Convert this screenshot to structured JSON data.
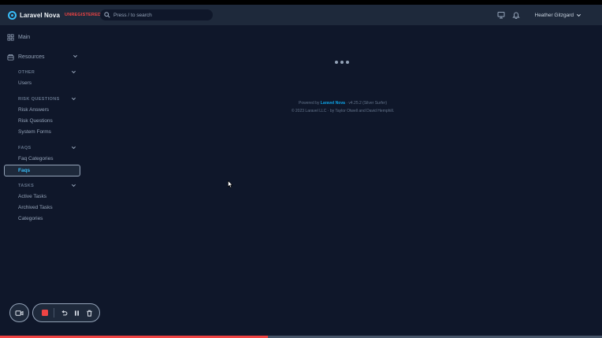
{
  "header": {
    "brand_name": "Laravel Nova",
    "brand_badge": "UNREGISTERED",
    "search_placeholder": "Press / to search",
    "user_name": "Heather Gitzgard"
  },
  "sidebar": {
    "main_label": "Main",
    "resources_label": "Resources",
    "groups": [
      {
        "title": "OTHER",
        "items": [
          "Users"
        ]
      },
      {
        "title": "RISK QUESTIONS",
        "items": [
          "Risk Answers",
          "Risk Questions",
          "System Forms"
        ]
      },
      {
        "title": "FAQS",
        "items": [
          "Faq Categories",
          "Faqs"
        ]
      },
      {
        "title": "TASKS",
        "items": [
          "Active Tasks",
          "Archived Tasks",
          "Categories"
        ]
      }
    ],
    "active_item": "Faqs"
  },
  "footer": {
    "powered_by": "Powered by",
    "link_text": "Laravel Nova",
    "version": "· v4.25.2 (Silver Surfer)",
    "copyright": "© 2023 Laravel LLC · by Taylor Otwell and David Hemphill."
  },
  "recorder": {
    "progress": 0.445
  },
  "colors": {
    "background": "#0f172a",
    "header": "#1e293b",
    "accent": "#38bdf8",
    "badge": "#ef4444",
    "record": "#ef4444"
  },
  "icons": [
    "nova-logo-icon",
    "search-icon",
    "monitor-icon",
    "bell-icon",
    "chevron-down-icon",
    "grid-icon",
    "inbox-icon",
    "video-camera-icon",
    "stop-icon",
    "undo-icon",
    "pause-icon",
    "trash-icon",
    "cursor-icon"
  ]
}
